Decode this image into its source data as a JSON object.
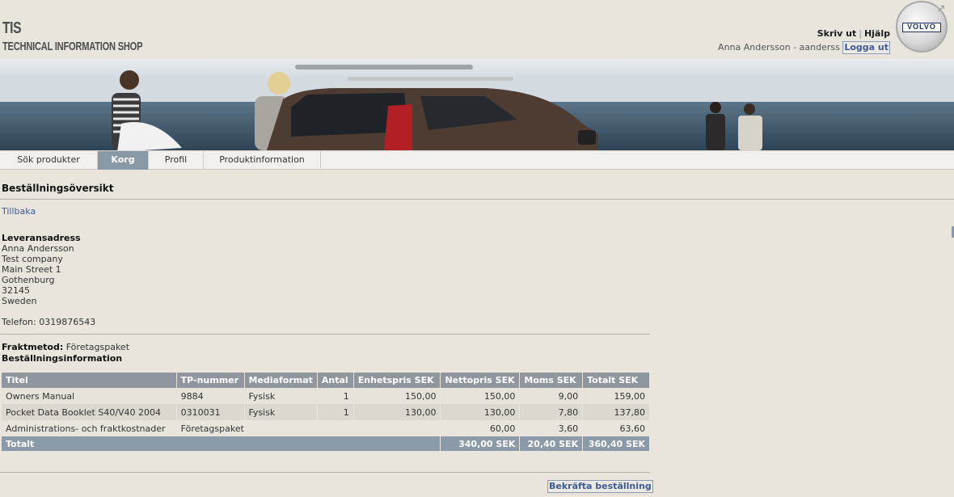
{
  "header": {
    "logo_title": "TIS",
    "logo_subtitle": "TECHNICAL INFORMATION SHOP",
    "print_label": "Skriv ut",
    "help_label": "Hjälp",
    "user_text": "Anna Andersson - aanderss",
    "logout_label": "Logga ut",
    "brand_badge": "VOLVO"
  },
  "tabs": [
    {
      "label": "Sök produkter",
      "active": false
    },
    {
      "label": "Korg",
      "active": true
    },
    {
      "label": "Profil",
      "active": false
    },
    {
      "label": "Produktinformation",
      "active": false
    }
  ],
  "main": {
    "title": "Beställningsöversikt",
    "back_label": "Tillbaka",
    "delivery": {
      "heading": "Leveransadress",
      "name": "Anna Andersson",
      "company": "Test company",
      "street": "Main Street 1",
      "city": "Gothenburg",
      "zip": "32145",
      "country": "Sweden",
      "phone": "Telefon: 0319876543"
    },
    "freight_label": "Fraktmetod:",
    "freight_value": "Företagspaket",
    "order_info_heading": "Beställningsinformation",
    "table": {
      "headers": [
        "Titel",
        "TP-nummer",
        "Mediaformat",
        "Antal",
        "Enhetspris SEK",
        "Nettopris SEK",
        "Moms SEK",
        "Totalt SEK"
      ],
      "rows": [
        {
          "title": "Owners Manual",
          "tp": "9884",
          "media": "Fysisk",
          "qty": "1",
          "unit": "150,00",
          "net": "150,00",
          "vat": "9,00",
          "total": "159,00"
        },
        {
          "title": "Pocket Data Booklet S40/V40 2004",
          "tp": "0310031",
          "media": "Fysisk",
          "qty": "1",
          "unit": "130,00",
          "net": "130,00",
          "vat": "7,80",
          "total": "137,80"
        }
      ],
      "fee_row": {
        "title": "Administrations- och fraktkostnader",
        "method": "Företagspaket",
        "net": "60,00",
        "vat": "3,60",
        "total": "63,60"
      },
      "total_row": {
        "label": "Totalt",
        "net": "340,00 SEK",
        "vat": "20,40 SEK",
        "total": "360,40 SEK"
      }
    },
    "confirm_label": "Bekräfta beställning"
  },
  "colors": {
    "background": "#e9e5dd",
    "link": "#3d5b92",
    "tab_active": "#8a99a6",
    "table_header": "#8f969d",
    "table_total": "#8b9aa8"
  }
}
